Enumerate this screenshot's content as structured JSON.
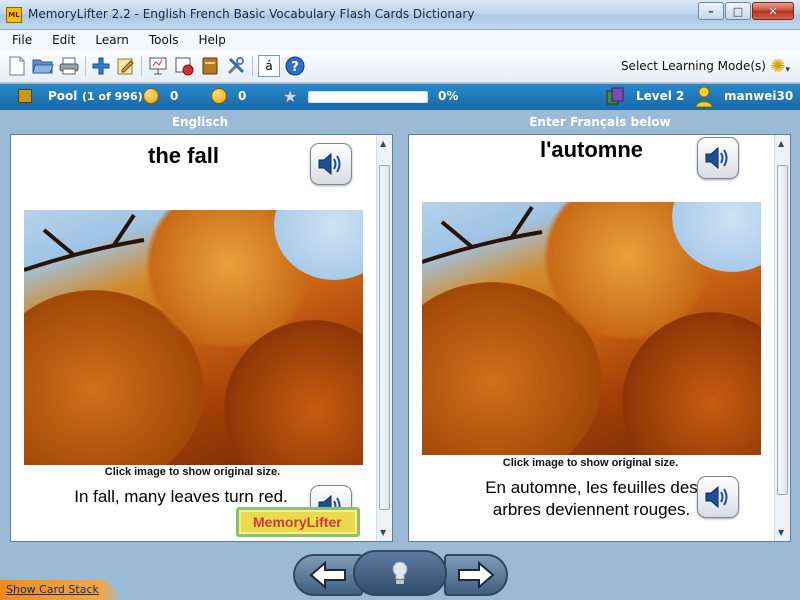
{
  "window": {
    "title": "MemoryLifter 2.2 - English French Basic Vocabulary Flash Cards Dictionary",
    "app_icon_text": "ML"
  },
  "menu": [
    "File",
    "Edit",
    "Learn",
    "Tools",
    "Help"
  ],
  "toolbar": {
    "learning_mode_label": "Select Learning Mode(s)",
    "accent_button_label": "á"
  },
  "status": {
    "pool_label": "Pool",
    "pool_count": "(1 of 996)",
    "correct_count": "0",
    "wrong_count": "0",
    "progress_percent": "0%",
    "progress_fraction": 0.0,
    "level": "Level 2",
    "user": "manwei30"
  },
  "left_panel": {
    "header": "Englisch",
    "word": "the fall",
    "image_caption": "Click image to show original size.",
    "sentence": "In fall, many leaves turn red.",
    "logo_text": "MemoryLifter"
  },
  "right_panel": {
    "header": "Enter Français below",
    "word": "l'automne",
    "image_caption": "Click image to show original size.",
    "sentence": "En automne, les feuilles des arbres deviennent rouges."
  },
  "footer": {
    "show_card_stack": "Show Card Stack"
  },
  "colors": {
    "statusbar": "#1f77b8",
    "background": "#9bbad6",
    "accent_orange": "#f08a1a"
  },
  "icons": [
    "new-icon",
    "open-icon",
    "print-icon",
    "add-icon",
    "edit-icon",
    "presentation-icon",
    "record-icon",
    "book-icon",
    "settings-icon",
    "help-icon",
    "speaker-icon",
    "smiley-icon",
    "star-icon",
    "cards-icon",
    "user-icon",
    "gear-icon",
    "arrow-left-icon",
    "arrow-right-icon",
    "lightbulb-icon"
  ]
}
